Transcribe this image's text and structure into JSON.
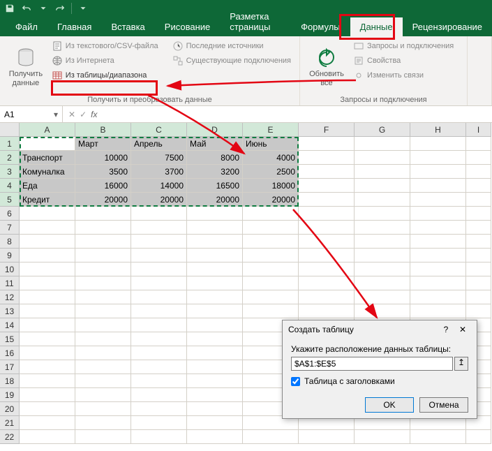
{
  "qat": {
    "save": "save-icon",
    "undo": "undo-icon",
    "redo": "redo-icon"
  },
  "tabs": {
    "file": "Файл",
    "items": [
      "Главная",
      "Вставка",
      "Рисование",
      "Разметка страницы",
      "Формулы",
      "Данные",
      "Рецензирование"
    ],
    "active_index": 5
  },
  "ribbon": {
    "group1": {
      "big": {
        "label": "Получить\nданные"
      },
      "items": [
        "Из текстового/CSV-файла",
        "Из Интернета",
        "Из таблицы/диапазона"
      ],
      "items_right": [
        "Последние источники",
        "Существующие подключения"
      ],
      "label": "Получить и преобразовать данные"
    },
    "group2": {
      "big": {
        "label": "Обновить\nвсе"
      },
      "items": [
        "Запросы и подключения",
        "Свойства",
        "Изменить связи"
      ],
      "label": "Запросы и подключения"
    }
  },
  "namebox": {
    "value": "A1",
    "fx": "fx"
  },
  "sheet": {
    "cols": [
      "A",
      "B",
      "C",
      "D",
      "E",
      "F",
      "G",
      "H",
      "I"
    ],
    "rows": [
      "1",
      "2",
      "3",
      "4",
      "5",
      "6",
      "7",
      "8",
      "9",
      "10",
      "11",
      "12",
      "13",
      "14",
      "15",
      "16",
      "17",
      "18",
      "19",
      "20",
      "21",
      "22"
    ],
    "sel_cols": 5,
    "sel_rows": 5,
    "headers": [
      "",
      "Март",
      "Апрель",
      "Май",
      "Июнь"
    ],
    "data": [
      {
        "label": "Транспорт",
        "vals": [
          "10000",
          "7500",
          "8000",
          "4000"
        ]
      },
      {
        "label": "Комуналка",
        "vals": [
          "3500",
          "3700",
          "3200",
          "2500"
        ]
      },
      {
        "label": "Еда",
        "vals": [
          "16000",
          "14000",
          "16500",
          "18000"
        ]
      },
      {
        "label": "Кредит",
        "vals": [
          "20000",
          "20000",
          "20000",
          "20000"
        ]
      }
    ]
  },
  "dialog": {
    "title": "Создать таблицу",
    "help": "?",
    "close": "✕",
    "prompt": "Укажите расположение данных таблицы:",
    "range": "$A$1:$E$5",
    "collapse": "↥",
    "checkbox": "Таблица с заголовками",
    "checked": true,
    "ok": "OK",
    "cancel": "Отмена"
  }
}
